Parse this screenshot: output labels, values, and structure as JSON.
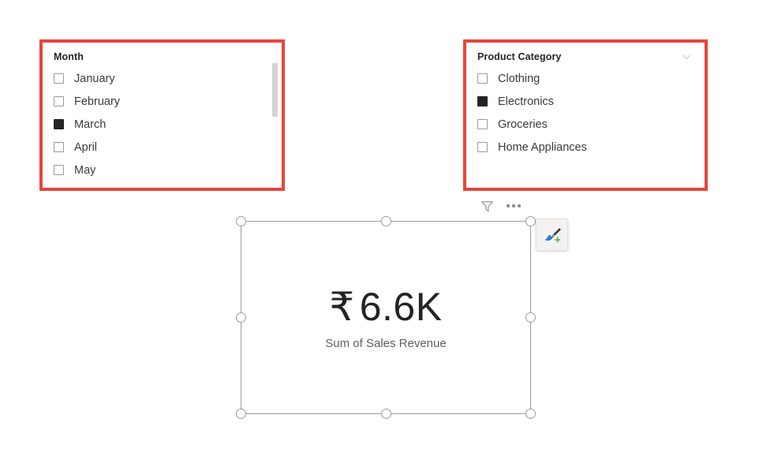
{
  "slicers": [
    {
      "name": "month",
      "title": "Month",
      "has_chevron": false,
      "has_scrollbar": true,
      "items": [
        {
          "label": "January",
          "checked": false
        },
        {
          "label": "February",
          "checked": false
        },
        {
          "label": "March",
          "checked": true
        },
        {
          "label": "April",
          "checked": false
        },
        {
          "label": "May",
          "checked": false
        },
        {
          "label": "",
          "checked": false
        }
      ]
    },
    {
      "name": "category",
      "title": "Product Category",
      "has_chevron": true,
      "chevron_icon": "chevron-down-icon",
      "has_scrollbar": false,
      "items": [
        {
          "label": "Clothing",
          "checked": false
        },
        {
          "label": "Electronics",
          "checked": true
        },
        {
          "label": "Groceries",
          "checked": false
        },
        {
          "label": "Home Appliances",
          "checked": false
        }
      ]
    }
  ],
  "visual_header": {
    "filter_icon": "filter-funnel-icon",
    "more_options_icon": "more-options-icon"
  },
  "card": {
    "currency_symbol": "₹",
    "value": "6.6K",
    "caption": "Sum of Sales Revenue"
  },
  "paint_button": {
    "icon": "paintbrush-add-icon"
  },
  "colors": {
    "highlight_border": "#e8453c",
    "selection_border": "#9b9b9b",
    "checkbox_checked": "#252423",
    "text_primary": "#252423",
    "text_secondary": "#605e5c",
    "scrollbar_thumb": "#d4d4d4",
    "paint_brush_blue": "#2b88d8",
    "paint_plus_green": "#4caf50"
  }
}
